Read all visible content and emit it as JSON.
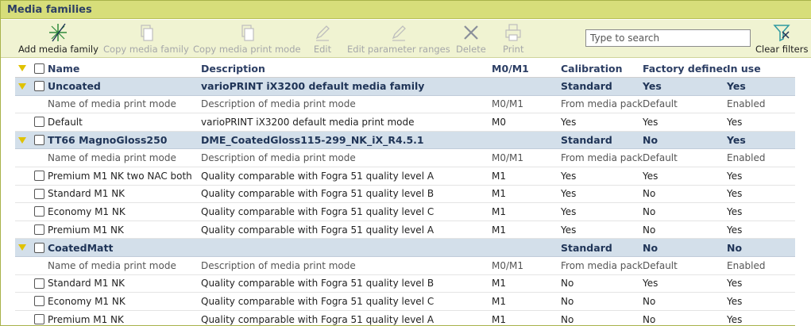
{
  "window": {
    "title": "Media families"
  },
  "toolbar": {
    "add_label": "Add media family",
    "copy_family_label": "Copy media family",
    "copy_mode_label": "Copy media print mode",
    "edit_label": "Edit",
    "edit_ranges_label": "Edit parameter ranges",
    "delete_label": "Delete",
    "print_label": "Print",
    "clear_filters_label": "Clear filters",
    "search_placeholder": "Type to search",
    "search_value": ""
  },
  "columns": {
    "name": "Name",
    "description": "Description",
    "m0m1": "M0/M1",
    "calibration": "Calibration",
    "factory": "Factory defined",
    "inuse": "In use"
  },
  "families": [
    {
      "name": "Uncoated",
      "description": "varioPRINT iX3200 default media family",
      "m0m1": "",
      "calibration": "Standard",
      "factory": "Yes",
      "inuse": "Yes",
      "mode_header": {
        "name": "Name of media print mode",
        "description": "Description of media print mode",
        "m0m1": "M0/M1",
        "calibration": "From media pack",
        "factory": "Default",
        "inuse": "Enabled"
      },
      "modes": [
        {
          "name": "Default",
          "description": "varioPRINT iX3200 default media print mode",
          "m0m1": "M0",
          "calibration": "Yes",
          "factory": "Yes",
          "inuse": "Yes"
        }
      ]
    },
    {
      "name": "TT66 MagnoGloss250",
      "description": "DME_CoatedGloss115-299_NK_iX_R4.5.1",
      "m0m1": "",
      "calibration": "Standard",
      "factory": "No",
      "inuse": "Yes",
      "mode_header": {
        "name": "Name of media print mode",
        "description": "Description of media print mode",
        "m0m1": "M0/M1",
        "calibration": "From media pack",
        "factory": "Default",
        "inuse": "Enabled"
      },
      "modes": [
        {
          "name": "Premium M1 NK two NAC both",
          "description": "Quality comparable with Fogra 51 quality level A",
          "m0m1": "M1",
          "calibration": "Yes",
          "factory": "Yes",
          "inuse": "Yes"
        },
        {
          "name": "Standard M1 NK",
          "description": "Quality comparable with Fogra 51 quality level B",
          "m0m1": "M1",
          "calibration": "Yes",
          "factory": "No",
          "inuse": "Yes"
        },
        {
          "name": "Economy M1 NK",
          "description": "Quality comparable with Fogra 51 quality level C",
          "m0m1": "M1",
          "calibration": "Yes",
          "factory": "No",
          "inuse": "Yes"
        },
        {
          "name": "Premium M1 NK",
          "description": "Quality comparable with Fogra 51 quality level A",
          "m0m1": "M1",
          "calibration": "Yes",
          "factory": "No",
          "inuse": "Yes"
        }
      ]
    },
    {
      "name": "CoatedMatt",
      "description": "",
      "m0m1": "",
      "calibration": "Standard",
      "factory": "No",
      "inuse": "No",
      "mode_header": {
        "name": "Name of media print mode",
        "description": "Description of media print mode",
        "m0m1": "M0/M1",
        "calibration": "From media pack",
        "factory": "Default",
        "inuse": "Enabled"
      },
      "modes": [
        {
          "name": "Standard M1 NK",
          "description": "Quality comparable with Fogra 51 quality level B",
          "m0m1": "M1",
          "calibration": "No",
          "factory": "Yes",
          "inuse": "Yes"
        },
        {
          "name": "Economy M1 NK",
          "description": "Quality comparable with Fogra 51 quality level C",
          "m0m1": "M1",
          "calibration": "No",
          "factory": "No",
          "inuse": "Yes"
        },
        {
          "name": "Premium M1 NK",
          "description": "Quality comparable with Fogra 51 quality level A",
          "m0m1": "M1",
          "calibration": "No",
          "factory": "No",
          "inuse": "Yes"
        }
      ]
    }
  ]
}
